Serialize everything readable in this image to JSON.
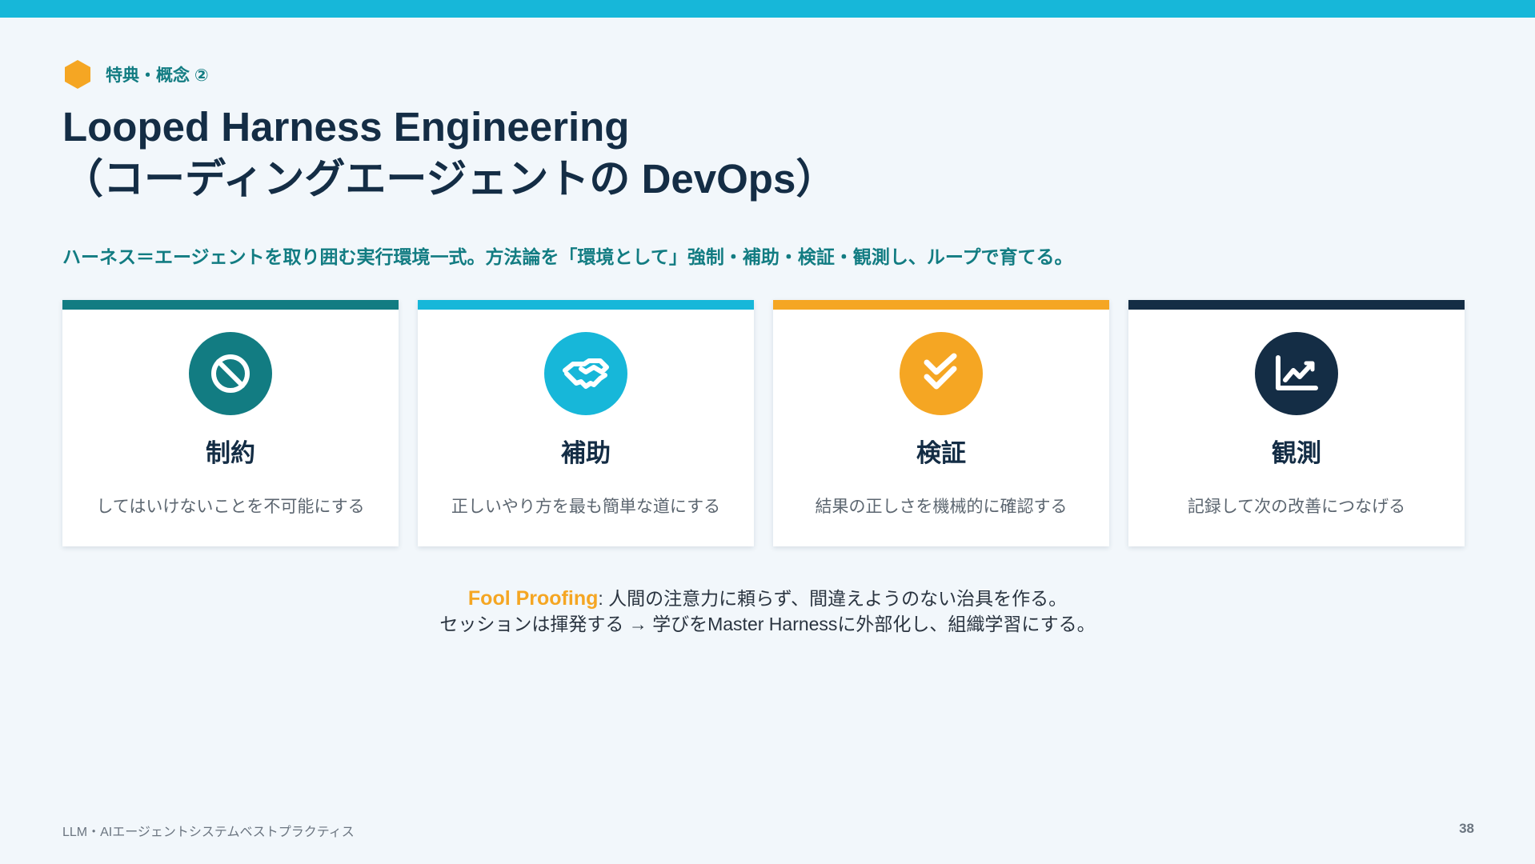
{
  "slide": {
    "section_label": "特典・概念 ②",
    "title_line1": "Looped Harness Engineering",
    "title_line2": "（コーディングエージェントの DevOps）",
    "subtitle": "ハーネス＝エージェントを取り囲む実行環境一式。方法論を「環境として」強制・補助・検証・観測し、ループで育てる。"
  },
  "cards": [
    {
      "title": "制約",
      "description": "してはいけないことを不可能にする",
      "icon": "ban-icon",
      "color": "#127c82"
    },
    {
      "title": "補助",
      "description": "正しいやり方を最も簡単な道にする",
      "icon": "handshake-icon",
      "color": "#17b7d9"
    },
    {
      "title": "検証",
      "description": "結果の正しさを機械的に確認する",
      "icon": "double-check-icon",
      "color": "#f5a623"
    },
    {
      "title": "観測",
      "description": "記録して次の改善につなげる",
      "icon": "chart-line-icon",
      "color": "#142d45"
    }
  ],
  "footnote": {
    "term": "Fool Proofing",
    "separator": ":",
    "line1": " 人間の注意力に頼らず、間違えようのない治具を作る。",
    "line2": "セッションは揮発する → 学びをMaster Harnessに外部化し、組織学習にする。"
  },
  "footer": {
    "left": "LLM・AIエージェントシステムベストプラクティス",
    "page_number": "38"
  },
  "colors": {
    "accent_top": "#17b7d9",
    "teal": "#127c82",
    "navy": "#142d45",
    "orange": "#f5a623",
    "background": "#f2f7fb"
  }
}
